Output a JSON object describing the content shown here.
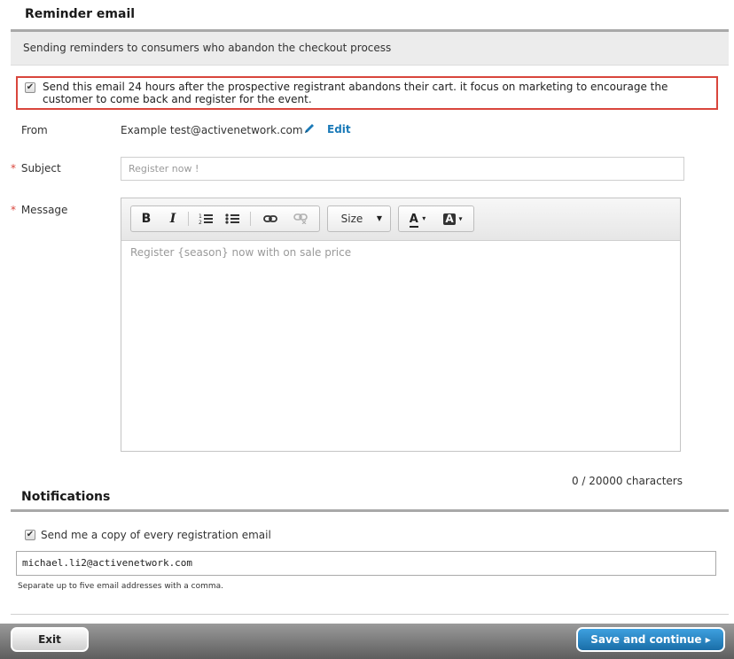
{
  "reminder": {
    "title": "Reminder email",
    "description": "Sending reminders to consumers who abandon the checkout process",
    "option_checked": true,
    "option_text": "Send this email 24 hours after the prospective registrant abandons their cart. it focus on marketing to encourage the customer to come back and register for the event."
  },
  "form": {
    "from_label": "From",
    "from_value": "Example  test@activenetwork.com",
    "edit_label": "Edit",
    "required_marker": "*",
    "subject_label": "Subject",
    "subject_placeholder": "Register now !",
    "message_label": "Message",
    "message_placeholder": "Register {season} now with on sale price",
    "char_count": "0 / 20000 characters"
  },
  "toolbar": {
    "bold": "B",
    "italic": "I",
    "numbered_list_icon": "numbered-list-icon",
    "bulleted_list_icon": "bulleted-list-icon",
    "link_icon": "link-icon",
    "unlink_icon": "unlink-icon",
    "size_label": "Size",
    "text_color_label": "A",
    "bg_color_label": "A"
  },
  "notifications": {
    "title": "Notifications",
    "copy_checked": true,
    "copy_label": "Send me a copy of every registration email",
    "email_value": "michael.li2@activenetwork.com",
    "hint": "Separate up to five email addresses with a comma."
  },
  "footer": {
    "exit_label": "Exit",
    "save_label": "Save and continue ▸"
  },
  "colors": {
    "accent_blue": "#1a7ab8",
    "highlight_red": "#d9463c",
    "footer_gray": "#6e6e6e"
  }
}
